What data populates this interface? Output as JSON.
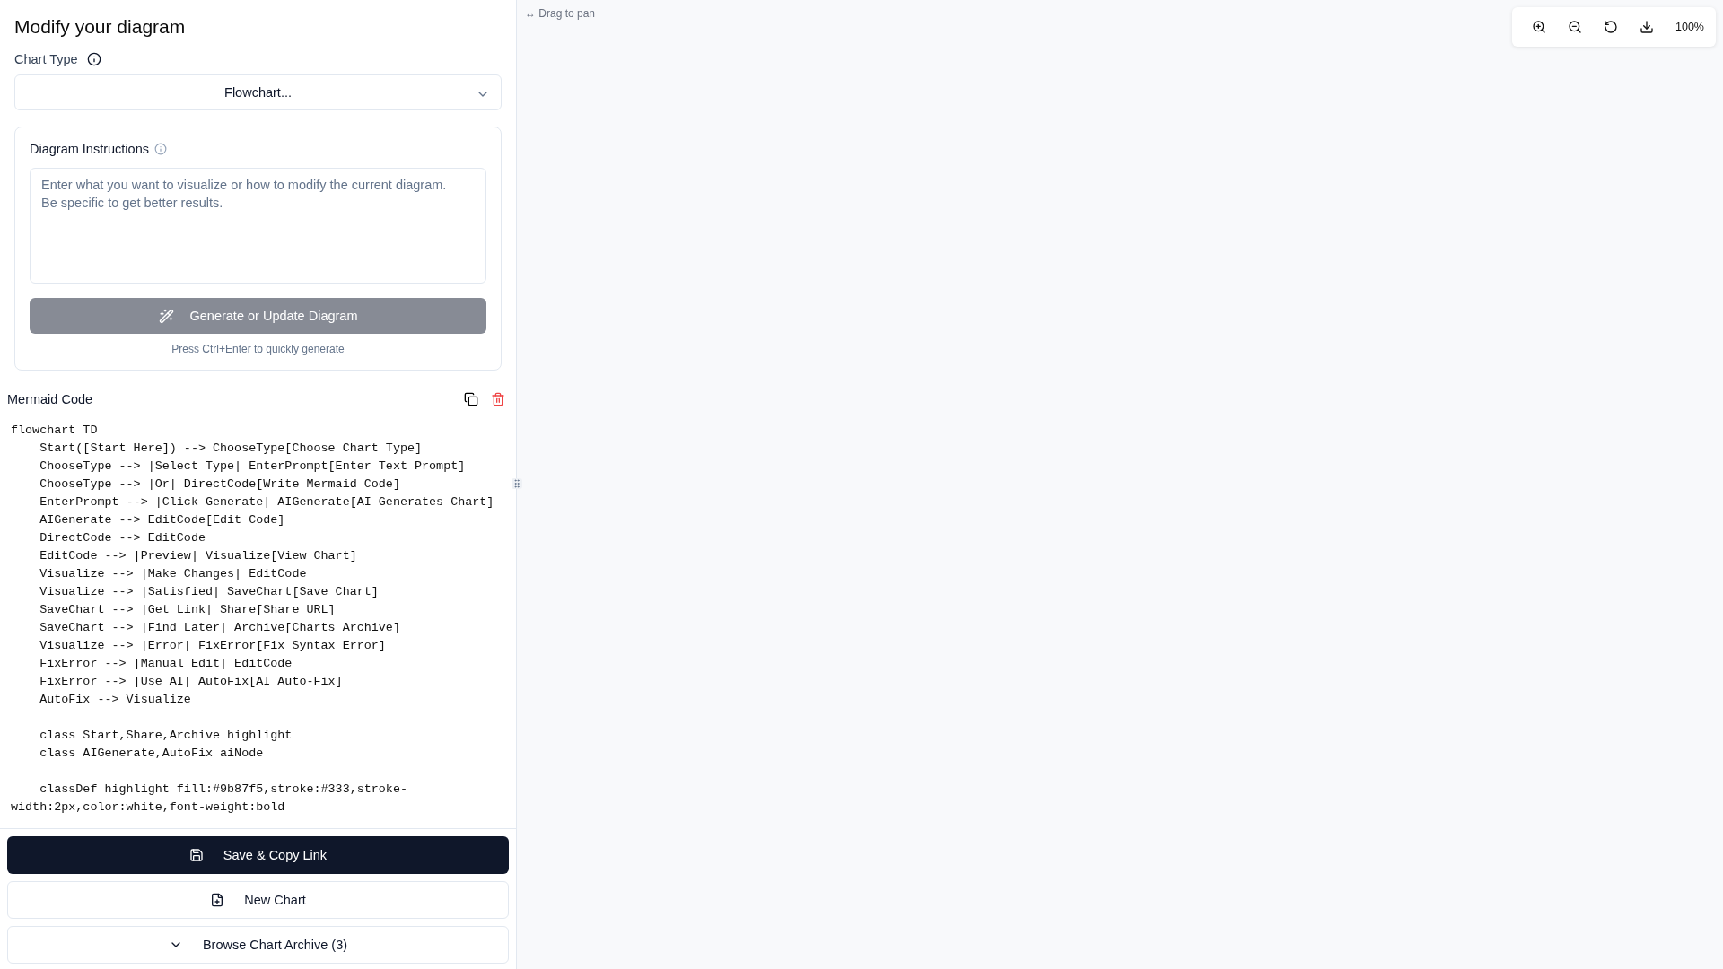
{
  "sidebar": {
    "title": "Modify your diagram",
    "chart_type": {
      "label": "Chart Type",
      "value": "Flowchart..."
    },
    "instructions": {
      "label": "Diagram Instructions",
      "placeholder": "Enter what you want to visualize or how to modify the current diagram.\nBe specific to get better results.",
      "button": {
        "label": "Generate or Update Diagram",
        "disabled": true
      },
      "hint": "Press Ctrl+Enter to quickly generate"
    },
    "code": {
      "label": "Mermaid Code",
      "text": "flowchart TD\n    Start([Start Here]) --> ChooseType[Choose Chart Type]\n    ChooseType --> |Select Type| EnterPrompt[Enter Text Prompt]\n    ChooseType --> |Or| DirectCode[Write Mermaid Code]\n    EnterPrompt --> |Click Generate| AIGenerate[AI Generates Chart]\n    AIGenerate --> EditCode[Edit Code]\n    DirectCode --> EditCode\n    EditCode --> |Preview| Visualize[View Chart]\n    Visualize --> |Make Changes| EditCode\n    Visualize --> |Satisfied| SaveChart[Save Chart]\n    SaveChart --> |Get Link| Share[Share URL]\n    SaveChart --> |Find Later| Archive[Charts Archive]\n    Visualize --> |Error| FixError[Fix Syntax Error]\n    FixError --> |Manual Edit| EditCode\n    FixError --> |Use AI| AutoFix[AI Auto-Fix]\n    AutoFix --> Visualize\n\n    class Start,Share,Archive highlight\n    class AIGenerate,AutoFix aiNode\n\n    classDef highlight fill:#9b87f5,stroke:#333,stroke-width:2px,color:white,font-weight:bold"
    },
    "actions": [
      {
        "kind": "save",
        "label": "Save & Copy Link"
      },
      {
        "kind": "new",
        "label": "New Chart"
      },
      {
        "kind": "archive",
        "label": "Browse Chart Archive (3)"
      }
    ]
  },
  "canvas": {
    "hint": "↔ Drag to pan",
    "toolbar": {
      "buttons": [
        {
          "kind": "zoom-in"
        },
        {
          "kind": "zoom-out"
        },
        {
          "kind": "reset"
        },
        {
          "kind": "download"
        }
      ],
      "zoom": "100%"
    }
  }
}
